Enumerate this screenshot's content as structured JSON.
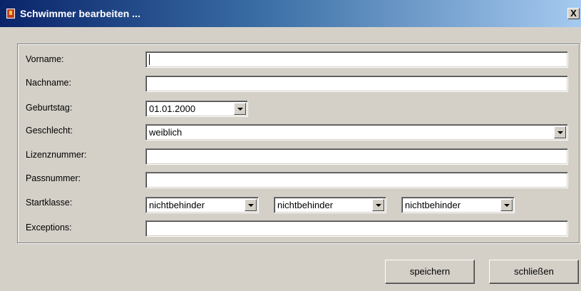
{
  "window": {
    "title": "Schwimmer bearbeiten ...",
    "close_glyph": "X"
  },
  "form": {
    "vorname": {
      "label": "Vorname:",
      "value": ""
    },
    "nachname": {
      "label": "Nachname:",
      "value": ""
    },
    "geburtstag": {
      "label": "Geburtstag:",
      "value": "01.01.2000"
    },
    "geschlecht": {
      "label": "Geschlecht:",
      "value": "weiblich"
    },
    "lizenznummer": {
      "label": "Lizenznummer:",
      "value": ""
    },
    "passnummer": {
      "label": "Passnummer:",
      "value": ""
    },
    "startklasse": {
      "label": "Startklasse:",
      "values": [
        "nichtbehinder",
        "nichtbehinder",
        "nichtbehinder"
      ]
    },
    "exceptions": {
      "label": "Exceptions:",
      "value": ""
    }
  },
  "buttons": {
    "save": "speichern",
    "close": "schließen"
  },
  "icons": {
    "title": "app-icon",
    "dropdown": "chevron-down-icon"
  },
  "colors": {
    "title_start": "#0a246a",
    "title_end": "#a6caf0",
    "face": "#d4d0c8"
  }
}
